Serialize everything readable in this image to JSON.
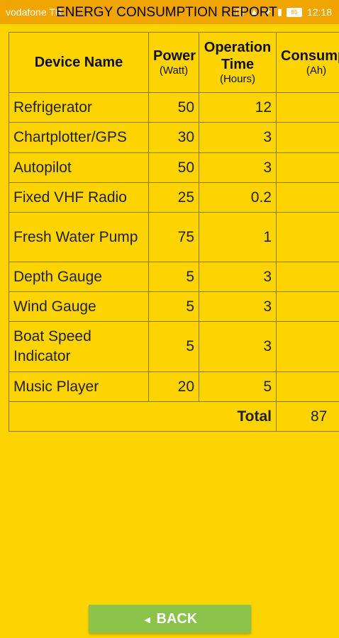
{
  "status_bar": {
    "carrier": "vodafone TR",
    "icons": "◫ ▲ ✈ ▮",
    "battery": "85",
    "time": "12:18"
  },
  "title": "ENERGY CONSUMPTION REPORT",
  "table": {
    "headers": {
      "device_name": "Device Name",
      "power": "Power",
      "power_unit": "(Watt)",
      "operation_time": "Operation Time",
      "operation_time_unit": "(Hours)",
      "consumption": "Consumption",
      "consumption_unit": "(Ah)"
    },
    "rows": [
      {
        "name": "Refrigerator",
        "power": "50",
        "time": "12",
        "consumption": ""
      },
      {
        "name": "Chartplotter/GPS",
        "power": "30",
        "time": "3",
        "consumption": ""
      },
      {
        "name": "Autopilot",
        "power": "50",
        "time": "3",
        "consumption": ""
      },
      {
        "name": "Fixed VHF Radio",
        "power": "25",
        "time": "0.2",
        "consumption": ""
      },
      {
        "name": "Fresh Water Pump",
        "power": "75",
        "time": "1",
        "consumption": ""
      },
      {
        "name": "Depth Gauge",
        "power": "5",
        "time": "3",
        "consumption": ""
      },
      {
        "name": "Wind Gauge",
        "power": "5",
        "time": "3",
        "consumption": ""
      },
      {
        "name": "Boat Speed Indicator",
        "power": "5",
        "time": "3",
        "consumption": ""
      },
      {
        "name": "Music Player",
        "power": "20",
        "time": "5",
        "consumption": ""
      }
    ],
    "total_label": "Total",
    "total_value": "87"
  },
  "back_button": {
    "arrow": "◄",
    "label": "BACK"
  }
}
